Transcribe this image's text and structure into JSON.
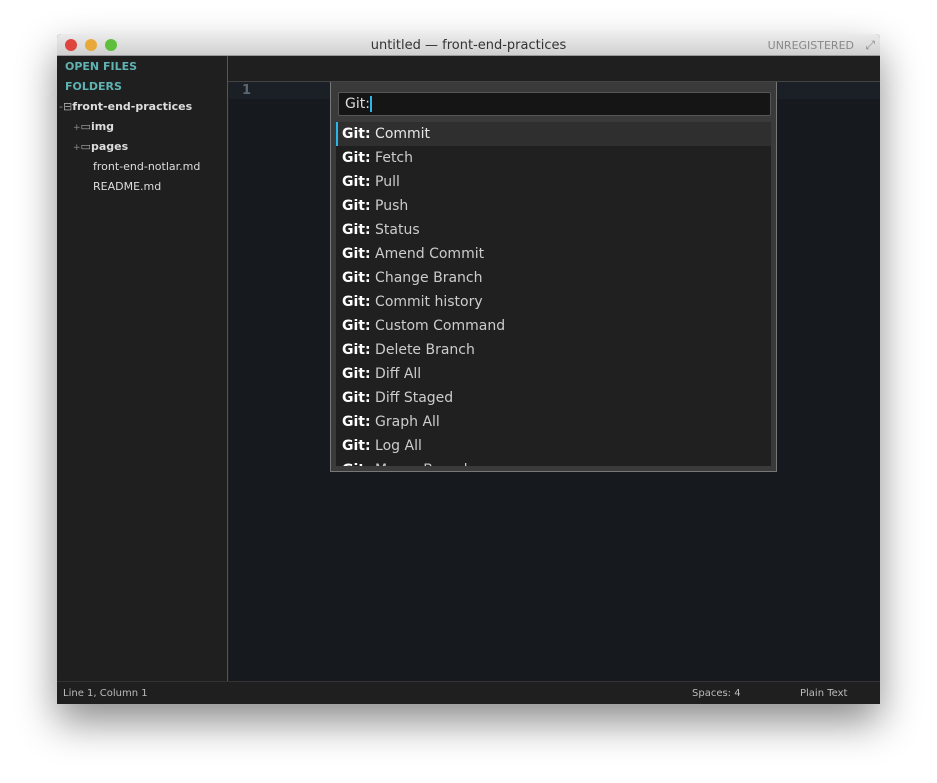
{
  "window": {
    "title": "untitled — front-end-practices",
    "registration": "UNREGISTERED"
  },
  "sidebar": {
    "open_files": "OPEN FILES",
    "folders": "FOLDERS",
    "tree": [
      {
        "label": "front-end-practices",
        "type": "folder",
        "expanded": true,
        "toggle": "-"
      },
      {
        "label": "img",
        "type": "folder",
        "expanded": false,
        "toggle": "+"
      },
      {
        "label": "pages",
        "type": "folder",
        "expanded": false,
        "toggle": "+"
      },
      {
        "label": "front-end-notlar.md",
        "type": "file"
      },
      {
        "label": "README.md",
        "type": "file"
      }
    ]
  },
  "editor": {
    "line_number": "1"
  },
  "palette": {
    "query": "Git:",
    "prefix": "Git:",
    "items": [
      "Commit",
      "Fetch",
      "Pull",
      "Push",
      "Status",
      "Amend Commit",
      "Change Branch",
      "Commit history",
      "Custom Command",
      "Delete Branch",
      "Diff All",
      "Diff Staged",
      "Graph All",
      "Log All",
      "Merge Branch"
    ],
    "selected_index": 0
  },
  "status": {
    "position": "Line 1, Column 1",
    "indent": "Spaces: 4",
    "syntax": "Plain Text"
  },
  "colors": {
    "accent": "#2bb5e8",
    "sidebar_heading": "#5fb3b3",
    "editor_bg": "#161a1f"
  }
}
